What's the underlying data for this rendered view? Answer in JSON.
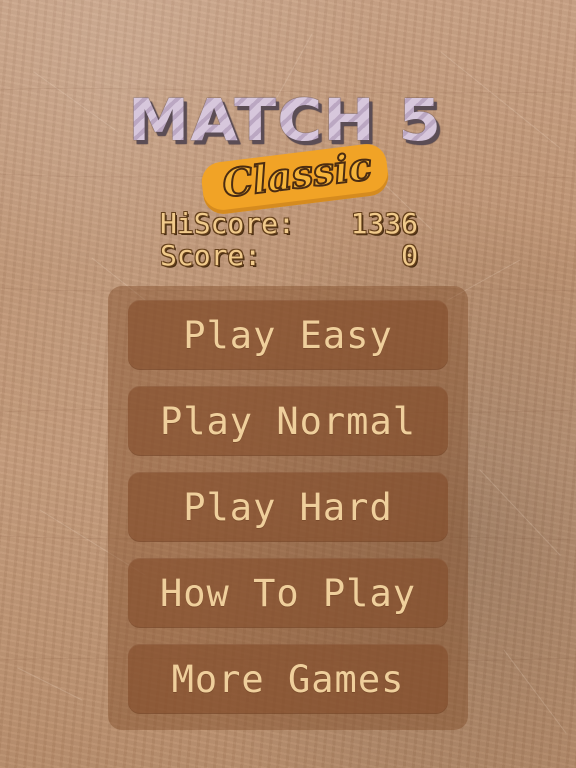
{
  "title": {
    "main": "MATCH 5",
    "subtitle": "Classic"
  },
  "scores": {
    "hiscore_label": "HiScore:",
    "hiscore_value": "1336",
    "score_label": "Score:",
    "score_value": "0"
  },
  "menu": {
    "items": [
      {
        "label": "Play Easy"
      },
      {
        "label": "Play Normal"
      },
      {
        "label": "Play Hard"
      },
      {
        "label": "How To Play"
      },
      {
        "label": "More Games"
      }
    ]
  },
  "colors": {
    "background_wood": "#be9372",
    "panel": "#7e4926",
    "button": "#824c2a",
    "button_text": "#efcf9c",
    "title_fill": "#cbb8cf",
    "title_shadow": "#5b4d55",
    "subtitle_fill": "#f6b53a",
    "subtitle_outline": "#4b2c11",
    "score_text": "#f0ca8b"
  }
}
